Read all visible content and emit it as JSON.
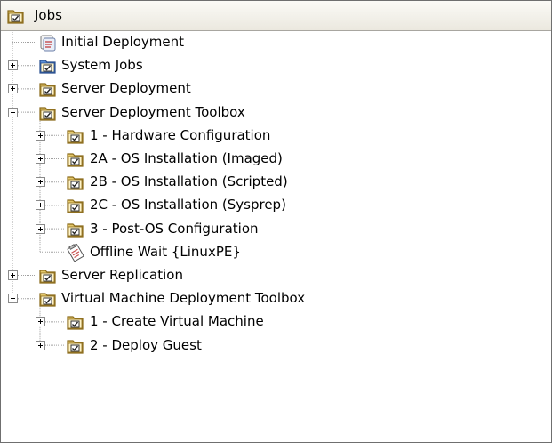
{
  "header": {
    "title": "Jobs",
    "icon": "job-folder-icon"
  },
  "tree": [
    {
      "label": "Initial Deployment",
      "level": 1,
      "expander": "none",
      "icon": "initial-deployment-icon"
    },
    {
      "label": "System Jobs",
      "level": 1,
      "expander": "plus",
      "icon": "system-folder-icon"
    },
    {
      "label": "Server Deployment",
      "level": 1,
      "expander": "plus",
      "icon": "job-folder-icon"
    },
    {
      "label": "Server Deployment Toolbox",
      "level": 1,
      "expander": "minus",
      "icon": "job-folder-icon"
    },
    {
      "label": "1 - Hardware Configuration",
      "level": 2,
      "expander": "plus",
      "icon": "job-folder-icon"
    },
    {
      "label": "2A - OS Installation (Imaged)",
      "level": 2,
      "expander": "plus",
      "icon": "job-folder-icon"
    },
    {
      "label": "2B - OS Installation (Scripted)",
      "level": 2,
      "expander": "plus",
      "icon": "job-folder-icon"
    },
    {
      "label": "2C - OS Installation (Sysprep)",
      "level": 2,
      "expander": "plus",
      "icon": "job-folder-icon"
    },
    {
      "label": "3 - Post-OS Configuration",
      "level": 2,
      "expander": "plus",
      "icon": "job-folder-icon"
    },
    {
      "label": "Offline Wait {LinuxPE}",
      "level": 2,
      "expander": "none",
      "icon": "job-task-icon"
    },
    {
      "label": "Server Replication",
      "level": 1,
      "expander": "plus",
      "icon": "job-folder-icon"
    },
    {
      "label": "Virtual Machine Deployment Toolbox",
      "level": 1,
      "expander": "minus",
      "icon": "job-folder-icon"
    },
    {
      "label": "1 - Create Virtual Machine",
      "level": 2,
      "expander": "plus",
      "icon": "job-folder-icon"
    },
    {
      "label": "2 - Deploy Guest",
      "level": 2,
      "expander": "plus",
      "icon": "job-folder-icon"
    }
  ],
  "colors": {
    "folder": "#e4c86a",
    "folder_dark": "#8a6a1a",
    "system_folder": "#5a8fd8",
    "tree_lines": "#a0a0a0"
  }
}
